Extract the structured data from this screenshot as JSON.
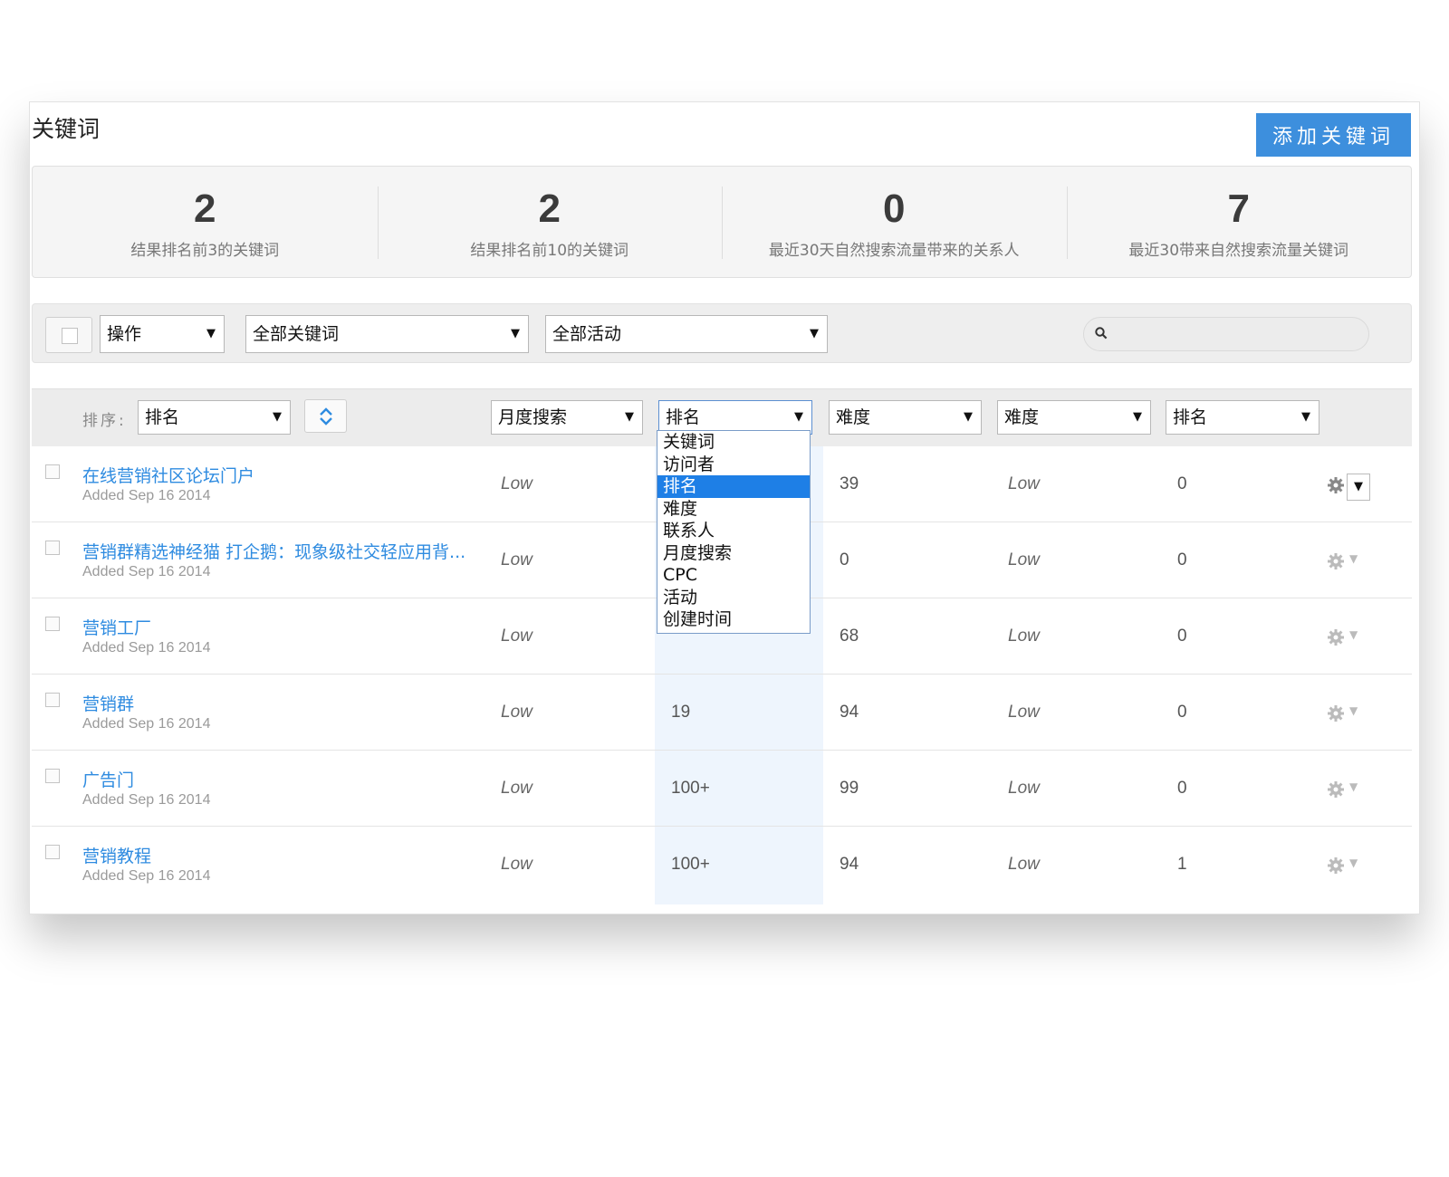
{
  "header": {
    "title": "关键词",
    "add_button": "添加关键词"
  },
  "stats": [
    {
      "value": "2",
      "label": "结果排名前3的关键词"
    },
    {
      "value": "2",
      "label": "结果排名前10的关键词"
    },
    {
      "value": "0",
      "label": "最近30天自然搜索流量带来的关系人"
    },
    {
      "value": "7",
      "label": "最近30带来自然搜索流量关键词"
    }
  ],
  "toolbar": {
    "action_select": "操作",
    "keyword_filter": "全部关键词",
    "campaign_filter": "全部活动",
    "search_placeholder": ""
  },
  "sortbar": {
    "label": "排序:",
    "sort_by": "排名",
    "columns": [
      "月度搜索",
      "排名",
      "难度",
      "难度",
      "排名"
    ]
  },
  "dropdown": {
    "options": [
      "关键词",
      "访问者",
      "排名",
      "难度",
      "联系人",
      "月度搜索",
      "CPC",
      "活动",
      "创建时间"
    ],
    "selected": "排名"
  },
  "rows": [
    {
      "keyword": "在线营销社区论坛门户",
      "added": "Added Sep 16 2014",
      "monthly": "Low",
      "rank": "",
      "difficulty": "39",
      "difficulty2": "Low",
      "rank2": "0"
    },
    {
      "keyword": "营销群精选神经猫 打企鹅：现象级社交轻应用背...",
      "added": "Added Sep 16 2014",
      "monthly": "Low",
      "rank": "",
      "difficulty": "0",
      "difficulty2": "Low",
      "rank2": "0"
    },
    {
      "keyword": "营销工厂",
      "added": "Added Sep 16 2014",
      "monthly": "Low",
      "rank": "",
      "difficulty": "68",
      "difficulty2": "Low",
      "rank2": "0"
    },
    {
      "keyword": "营销群",
      "added": "Added Sep 16 2014",
      "monthly": "Low",
      "rank": "19",
      "difficulty": "94",
      "difficulty2": "Low",
      "rank2": "0"
    },
    {
      "keyword": "广告门",
      "added": "Added Sep 16 2014",
      "monthly": "Low",
      "rank": "100+",
      "difficulty": "99",
      "difficulty2": "Low",
      "rank2": "0"
    },
    {
      "keyword": "营销教程",
      "added": "Added Sep 16 2014",
      "monthly": "Low",
      "rank": "100+",
      "difficulty": "94",
      "difficulty2": "Low",
      "rank2": "1"
    }
  ],
  "colors": {
    "accent": "#3d8fdd",
    "link": "#2e8be0",
    "selected": "#1e7fe6",
    "column_highlight": "#eef5fd"
  },
  "icons": {
    "search": "search-icon",
    "gear": "gear-icon",
    "sort_direction": "sort-toggle-icon"
  }
}
